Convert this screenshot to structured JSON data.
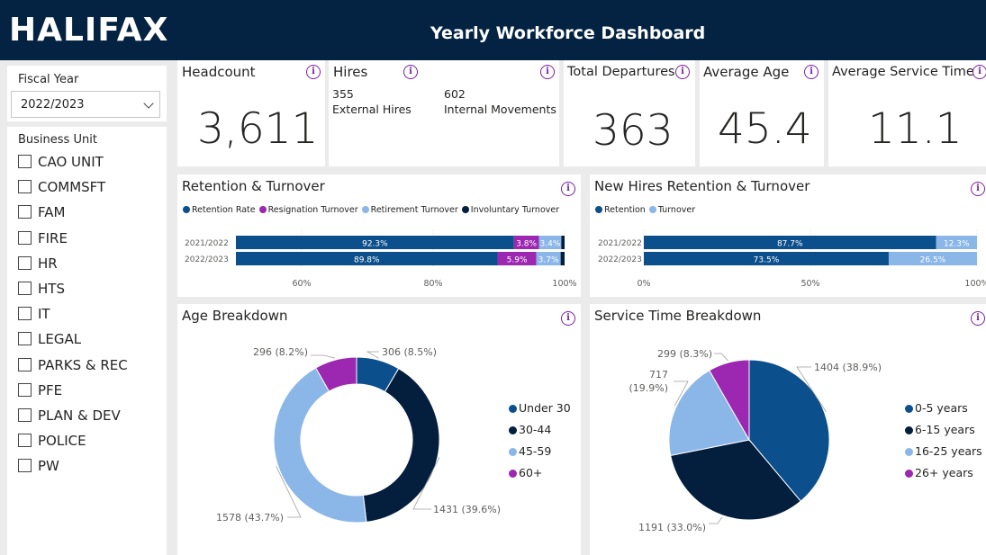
{
  "header": {
    "logo": "HALIFAX",
    "title": "Yearly Workforce Dashboard"
  },
  "filters": {
    "fiscal_year_label": "Fiscal Year",
    "fiscal_year_value": "2022/2023",
    "business_unit_label": "Business Unit",
    "business_units": [
      "CAO UNIT",
      "COMMSFT",
      "FAM",
      "FIRE",
      "HR",
      "HTS",
      "IT",
      "LEGAL",
      "PARKS & REC",
      "PFE",
      "PLAN & DEV",
      "POLICE",
      "PW"
    ]
  },
  "kpis": {
    "headcount": {
      "label": "Headcount",
      "value": "3,611"
    },
    "hires": {
      "label": "Hires",
      "external_value": "355",
      "external_label": "External Hires",
      "internal_value": "602",
      "internal_label": "Internal Movements"
    },
    "departures": {
      "label": "Total Departures",
      "value": "363"
    },
    "age": {
      "label": "Average Age",
      "value": "45.4"
    },
    "service": {
      "label": "Average Service Time",
      "value": "11.1"
    }
  },
  "info_icon_glyph": "i",
  "colors": {
    "navy": "#042342",
    "blue": "#0b4f8c",
    "purple": "#9c27b0",
    "light_blue": "#8ab6e8",
    "dark": "#041e3d",
    "accent": "#7b1fa2"
  },
  "chart_data": [
    {
      "type": "bar",
      "orientation": "horizontal-stacked",
      "title": "Retention & Turnover",
      "legend_position": "top",
      "categories": [
        "2021/2022",
        "2022/2023"
      ],
      "series": [
        {
          "name": "Retention Rate",
          "values": [
            92.3,
            89.8
          ],
          "labels": [
            "92.3%",
            "89.8%"
          ],
          "color": "#0b4f8c"
        },
        {
          "name": "Resignation Turnover",
          "values": [
            3.8,
            5.9
          ],
          "labels": [
            "3.8%",
            "5.9%"
          ],
          "color": "#9c27b0"
        },
        {
          "name": "Retirement Turnover",
          "values": [
            3.4,
            3.7
          ],
          "labels": [
            "3.4%",
            "3.7%"
          ],
          "color": "#8ab6e8"
        },
        {
          "name": "Involuntary Turnover",
          "values": [
            0.5,
            0.6
          ],
          "labels": [
            "",
            ""
          ],
          "color": "#041e3d"
        }
      ],
      "xlim": [
        50,
        100
      ],
      "ticks": [
        60,
        80,
        100
      ],
      "tick_labels": [
        "60%",
        "80%",
        "100%"
      ]
    },
    {
      "type": "bar",
      "orientation": "horizontal-stacked",
      "title": "New Hires Retention & Turnover",
      "legend_position": "top",
      "categories": [
        "2021/2022",
        "2022/2023"
      ],
      "series": [
        {
          "name": "Retention",
          "values": [
            87.7,
            73.5
          ],
          "labels": [
            "87.7%",
            "73.5%"
          ],
          "color": "#0b4f8c"
        },
        {
          "name": "Turnover",
          "values": [
            12.3,
            26.5
          ],
          "labels": [
            "12.3%",
            "26.5%"
          ],
          "color": "#8ab6e8"
        }
      ],
      "xlim": [
        0,
        100
      ],
      "ticks": [
        0,
        50,
        100
      ],
      "tick_labels": [
        "0%",
        "50%",
        "100%"
      ]
    },
    {
      "type": "pie",
      "variant": "donut",
      "title": "Age Breakdown",
      "legend_position": "right",
      "categories": [
        "Under 30",
        "30-44",
        "45-59",
        "60+"
      ],
      "values": [
        306,
        1431,
        1578,
        296
      ],
      "labels": [
        "306 (8.5%)",
        "1431 (39.6%)",
        "1578 (43.7%)",
        "296 (8.2%)"
      ],
      "colors": [
        "#0b4f8c",
        "#041e3d",
        "#8ab6e8",
        "#9c27b0"
      ]
    },
    {
      "type": "pie",
      "title": "Service Time Breakdown",
      "legend_position": "right",
      "categories": [
        "0-5 years",
        "6-15 years",
        "16-25 years",
        "26+ years"
      ],
      "values": [
        1404,
        1191,
        717,
        299
      ],
      "labels": [
        "1404 (38.9%)",
        "1191 (33.0%)",
        "717\n(19.9%)",
        "299 (8.3%)"
      ],
      "colors": [
        "#0b4f8c",
        "#041e3d",
        "#8ab6e8",
        "#9c27b0"
      ]
    }
  ]
}
